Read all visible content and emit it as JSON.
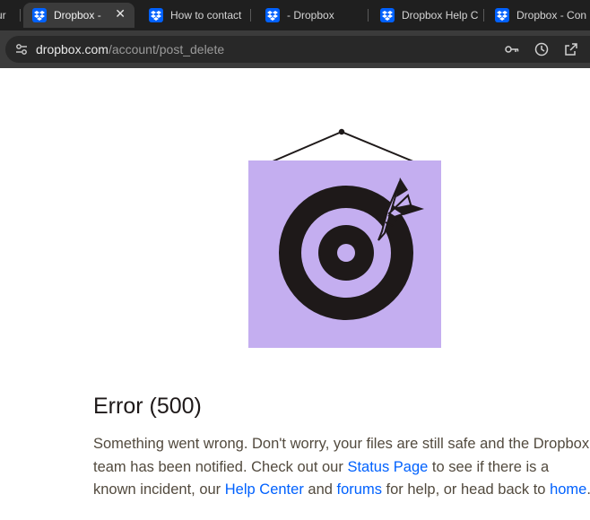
{
  "browser": {
    "tabs": [
      {
        "title": "ur",
        "active": false
      },
      {
        "title": "Dropbox - ",
        "active": true
      },
      {
        "title": "How to contact",
        "active": false
      },
      {
        "title": "- Dropbox",
        "active": false
      },
      {
        "title": "Dropbox Help C",
        "active": false
      },
      {
        "title": "Dropbox - Con",
        "active": false
      }
    ],
    "close_glyph": "✕",
    "url_host": "dropbox.com",
    "url_path": "/account/post_delete",
    "icons": [
      "tune-icon",
      "key-icon",
      "history-icon",
      "share-icon"
    ]
  },
  "illustration": {
    "colors": {
      "frame": "#c4aef0",
      "target": "#1e1919",
      "line": "#1e1919"
    }
  },
  "error": {
    "title": "Error (500)",
    "message_1": "Something went wrong. Don't worry, your files are still safe and the Dropbox team has been notified. Check out our ",
    "status_link": "Status Page",
    "message_2": " to see if there is a known incident, our ",
    "help_link": "Help Center",
    "message_3": " and ",
    "forums_link": "forums",
    "message_4": " for help, or head back to ",
    "home_link": "home",
    "message_5": "."
  },
  "colors": {
    "link": "#0061fe",
    "brand": "#0061fe"
  }
}
